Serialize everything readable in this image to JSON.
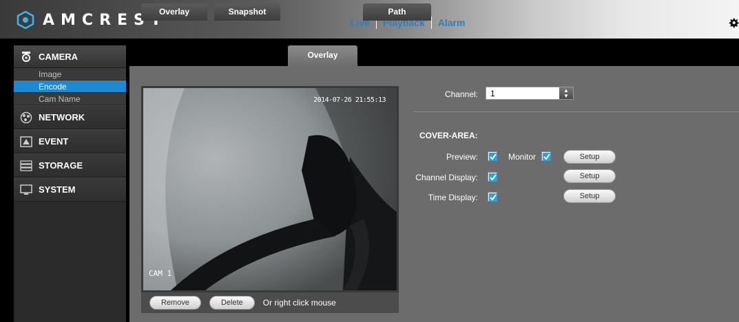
{
  "brand": {
    "name": "AMCREST"
  },
  "top_nav": [
    {
      "label": "Live"
    },
    {
      "label": "Playback"
    },
    {
      "label": "Alarm"
    }
  ],
  "sidebar": {
    "camera": {
      "label": "CAMERA",
      "items": [
        "Image",
        "Encode",
        "Cam Name"
      ],
      "active": "Encode"
    },
    "sections": [
      {
        "label": "NETWORK",
        "icon": "network-icon"
      },
      {
        "label": "EVENT",
        "icon": "event-icon"
      },
      {
        "label": "STORAGE",
        "icon": "storage-icon"
      },
      {
        "label": "SYSTEM",
        "icon": "system-icon"
      }
    ]
  },
  "tabs": [
    {
      "label": "Overlay"
    },
    {
      "label": "Snapshot"
    },
    {
      "label": "Overlay",
      "active": true
    },
    {
      "label": "Path"
    }
  ],
  "video": {
    "timestamp": "2014-07-26 21:55:13",
    "cam_label": "CAM 1",
    "remove_label": "Remove",
    "delete_label": "Delete",
    "hint": "Or right click mouse"
  },
  "form": {
    "channel_label": "Channel:",
    "channel_value": "1",
    "section_title": "COVER-AREA:",
    "preview_label": "Preview:",
    "preview_checked": true,
    "monitor_label": "Monitor",
    "monitor_checked": true,
    "channel_display_label": "Channel Display:",
    "channel_display_checked": true,
    "time_display_label": "Time Display:",
    "time_display_checked": true,
    "setup_label": "Setup"
  },
  "colors": {
    "accent": "#1a8ad4",
    "nav_link": "#2b7fc0",
    "check": "#2aa0e0"
  }
}
